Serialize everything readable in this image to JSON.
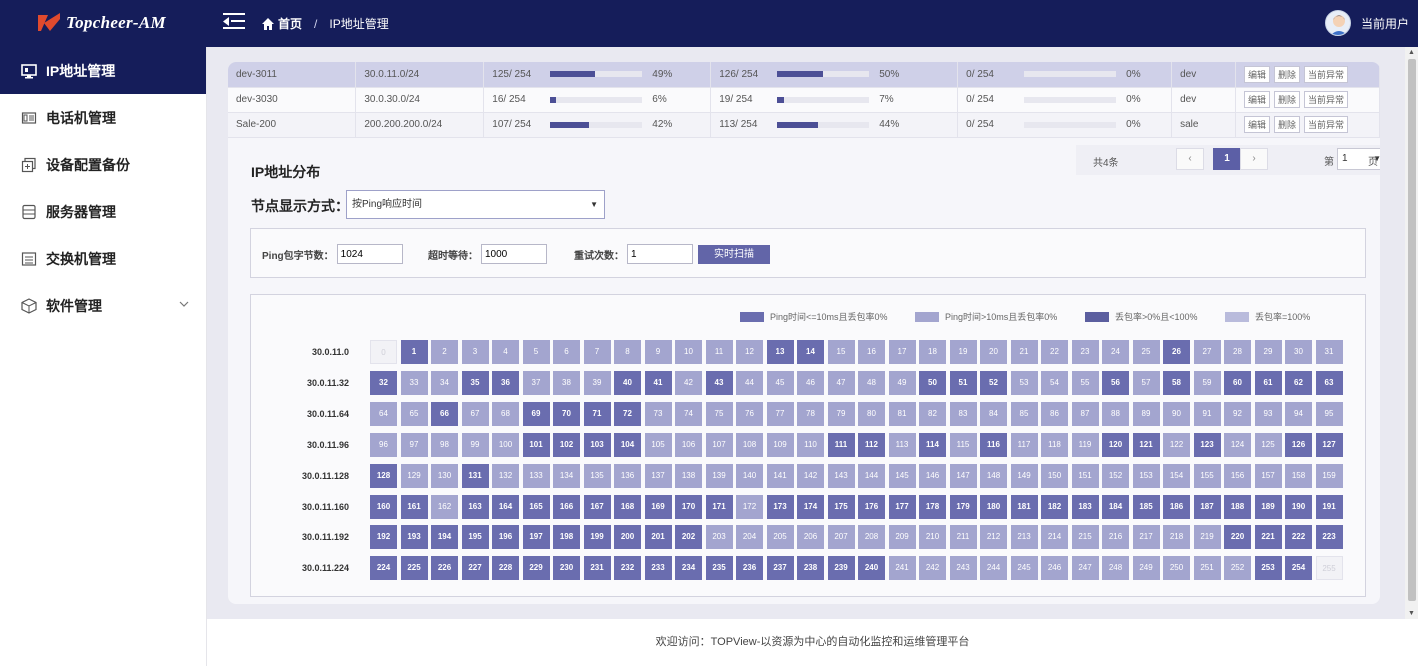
{
  "app": {
    "logo_text": "Topcheer-AM",
    "breadcrumb_home": "首页",
    "breadcrumb_sep": "/",
    "breadcrumb_current": "IP地址管理",
    "user_name": "当前用户"
  },
  "sidebar": {
    "items": [
      {
        "label": "IP地址管理",
        "icon": "monitor-icon",
        "active": true
      },
      {
        "label": "电话机管理",
        "icon": "phone-icon",
        "active": false
      },
      {
        "label": "设备配置备份",
        "icon": "backup-icon",
        "active": false
      },
      {
        "label": "服务器管理",
        "icon": "server-icon",
        "active": false
      },
      {
        "label": "交换机管理",
        "icon": "switch-icon",
        "active": false
      },
      {
        "label": "软件管理",
        "icon": "cube-icon",
        "active": false,
        "expandable": true
      }
    ]
  },
  "table": {
    "rows": [
      {
        "name": "dev-3011",
        "subnet": "30.0.11.0/24",
        "u1": "125/ 254",
        "p1": "49%",
        "f1": 0.49,
        "u2": "126/ 254",
        "p2": "50%",
        "f2": 0.5,
        "u3": "0/ 254",
        "p3": "0%",
        "f3": 0,
        "group": "dev"
      },
      {
        "name": "dev-3030",
        "subnet": "30.0.30.0/24",
        "u1": "16/ 254",
        "p1": "6%",
        "f1": 0.06,
        "u2": "19/ 254",
        "p2": "7%",
        "f2": 0.07,
        "u3": "0/ 254",
        "p3": "0%",
        "f3": 0,
        "group": "dev"
      },
      {
        "name": "Sale-200",
        "subnet": "200.200.200.0/24",
        "u1": "107/ 254",
        "p1": "42%",
        "f1": 0.42,
        "u2": "113/ 254",
        "p2": "44%",
        "f2": 0.44,
        "u3": "0/ 254",
        "p3": "0%",
        "f3": 0,
        "group": "sale"
      }
    ],
    "op_edit": "编辑",
    "op_delete": "删除",
    "op_alerts": "当前异常"
  },
  "pager": {
    "total": "共4条",
    "prev": "‹",
    "current": "1",
    "next": "›",
    "page_prefix": "第",
    "page_value": "1",
    "page_suffix": "页"
  },
  "distribution": {
    "title": "IP地址分布",
    "mode_label": "节点显示方式：",
    "mode_value": "按Ping响应时间"
  },
  "params": {
    "size_label": "Ping包字节数：",
    "size_value": "1024",
    "timeout_label": "超时等待：",
    "timeout_value": "1000",
    "retry_label": "重试次数：",
    "retry_value": "1",
    "scan_button": "实时扫描"
  },
  "legend": [
    {
      "label": "Ping时间<=10ms且丢包率0%",
      "color": "#6a6daf"
    },
    {
      "label": "Ping时间>10ms且丢包率0%",
      "color": "#a3a5cf"
    },
    {
      "label": "丢包率>0%且<100%",
      "color": "#5b5e9f"
    },
    {
      "label": "丢包率=100%",
      "color": "#b9bbdc"
    }
  ],
  "ip_grid": {
    "row_labels": [
      "30.0.11.0",
      "30.0.11.32",
      "30.0.11.64",
      "30.0.11.96",
      "30.0.11.128",
      "30.0.11.160",
      "30.0.11.192",
      "30.0.11.224"
    ],
    "dark_cells": [
      1,
      13,
      14,
      26,
      32,
      35,
      36,
      40,
      41,
      43,
      50,
      51,
      52,
      56,
      58,
      60,
      61,
      62,
      63,
      66,
      69,
      70,
      71,
      72,
      101,
      102,
      103,
      104,
      111,
      112,
      114,
      116,
      120,
      121,
      123,
      126,
      127,
      128,
      131,
      160,
      161,
      163,
      164,
      165,
      166,
      167,
      168,
      169,
      170,
      171,
      173,
      174,
      175,
      176,
      177,
      178,
      179,
      180,
      181,
      182,
      183,
      184,
      185,
      186,
      187,
      188,
      189,
      190,
      191,
      192,
      193,
      194,
      195,
      196,
      197,
      198,
      199,
      200,
      201,
      202,
      220,
      221,
      222,
      223,
      224,
      225,
      226,
      227,
      228,
      229,
      230,
      231,
      232,
      233,
      234,
      235,
      236,
      237,
      238,
      239,
      240,
      253,
      254
    ],
    "empty_cells": [
      0,
      255
    ]
  },
  "footer": {
    "text": "欢迎访问：TOPView-以资源为中心的自动化监控和运维管理平台"
  }
}
